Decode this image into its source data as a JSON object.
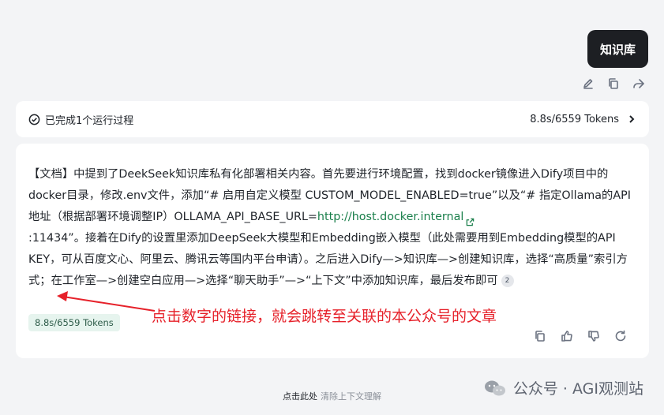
{
  "user_message": "知识库",
  "process": {
    "status": "已完成1个运行过程",
    "stats": "8.8s/6559 Tokens"
  },
  "answer": {
    "part1": "【文档】中提到了DeekSeek知识库私有化部署相关内容。首先要进行环境配置，找到docker镜像进入Dify项目中的docker目录，修改.env文件，添加“# 启用自定义模型 CUSTOM_MODEL_ENABLED=true”以及“# 指定Ollama的API地址（根据部署环境调整IP）OLLAMA_API_BASE_URL=",
    "link": "http://host.docker.internal",
    "part2": ":11434”。接着在Dify的设置里添加DeepSeek大模型和Embedding嵌入模型（此处需要用到Embedding模型的API KEY，可从百度文心、阿里云、腾讯云等国内平台申请）。之后进入Dify—>知识库—>创建知识库，选择“高质量”索引方式；在工作室—>创建空白应用—>选择“聊天助手”—>“上下文”中添加知识库，最后发布即可",
    "citation": "2",
    "tokens": "8.8s/6559 Tokens"
  },
  "annotation": "点击数字的链接，就会跳转至关联的本公众号的文章",
  "footer": {
    "action": "点击此处",
    "hint": "清除上下文理解"
  },
  "watermark": "公众号 · AGI观测站"
}
